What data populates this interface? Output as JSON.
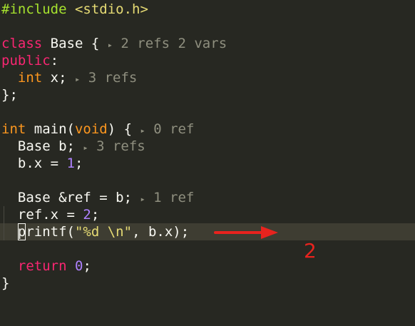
{
  "code": {
    "line1": {
      "directive": "#include",
      "header": "<stdio.h>"
    },
    "line3": {
      "kw": "class",
      "name": " Base {",
      "hint_arrow": "▸",
      "hint": "2 refs 2 vars"
    },
    "line4": {
      "kw": "public",
      "colon": ":"
    },
    "line5": {
      "type": "int",
      "rest": " x;",
      "hint_arrow": "▸",
      "hint": "3 refs"
    },
    "line6": {
      "text": "};"
    },
    "line8": {
      "type": "int",
      "mid": " main(",
      "param": "void",
      "end": ") {",
      "hint_arrow": "▸",
      "hint": "0 ref"
    },
    "line9": {
      "text": "  Base b;",
      "hint_arrow": "▸",
      "hint": "3 refs"
    },
    "line10": {
      "pre": "  b.x = ",
      "num": "1",
      "post": ";"
    },
    "line12": {
      "text": "  Base &ref = b;",
      "hint_arrow": "▸",
      "hint": "1 ref"
    },
    "line13": {
      "pre": "  ref.x = ",
      "num": "2",
      "post": ";"
    },
    "line14": {
      "indent": "  ",
      "cursor_char": "p",
      "fn": "rintf(",
      "str": "\"%d \\n\"",
      "rest": ", b.x);"
    },
    "line16": {
      "indent": "  ",
      "kw": "return",
      "sp": " ",
      "num": "0",
      "post": ";"
    },
    "line17": {
      "text": "}"
    }
  },
  "annotation": {
    "label": "2",
    "color": "#e8231e"
  },
  "colors": {
    "background": "#272822",
    "current_line": "#3e3d32",
    "keyword": "#f92672",
    "type": "#66d9ef",
    "string": "#e6db74",
    "number": "#ae81ff",
    "hint": "#8f8f7f"
  }
}
